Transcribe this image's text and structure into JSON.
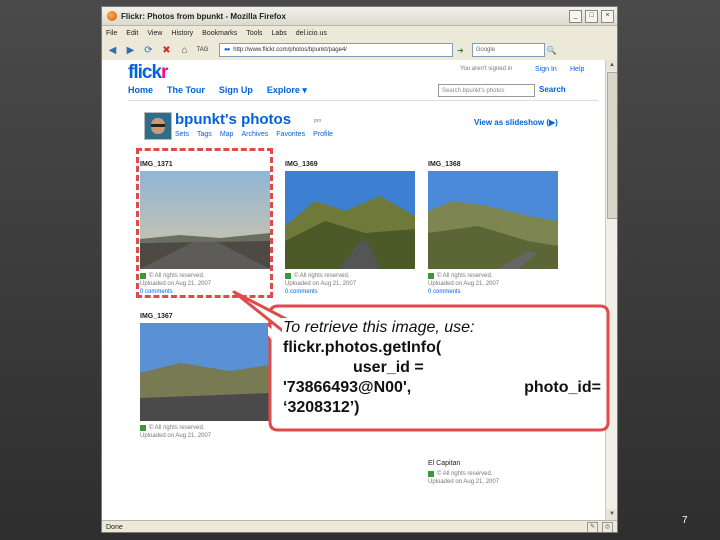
{
  "browser": {
    "title": "Flickr: Photos from bpunkt - Mozilla Firefox",
    "menu": [
      "File",
      "Edit",
      "View",
      "History",
      "Bookmarks",
      "Tools",
      "Labs",
      "del.icio.us"
    ],
    "url": "http://www.flickr.com/photos/bpunkt/page4/",
    "tag_label": "TAG",
    "search_placeholder": "Google",
    "status": "Done"
  },
  "flickr": {
    "logo_a": "flick",
    "logo_b": "r",
    "signed_out": "You aren't signed in",
    "sign_in": "Sign In",
    "help": "Help",
    "nav": [
      "Home",
      "The Tour",
      "Sign Up",
      "Explore ▾"
    ],
    "search_placeholder": "Search bpunkt's photos",
    "search_button": "Search",
    "owner_title": "bpunkt's photos",
    "badge": "pro",
    "subnav": [
      "Sets",
      "Tags",
      "Map",
      "Archives",
      "Favorites",
      "Profile"
    ],
    "slideshow": "View as slideshow (▶)"
  },
  "photos": [
    {
      "title": "IMG_1371",
      "license": "© All rights reserved.",
      "uploaded": "Uploaded on Aug 21, 2007",
      "comments": "0 comments"
    },
    {
      "title": "IMG_1369",
      "license": "© All rights reserved.",
      "uploaded": "Uploaded on Aug 21, 2007",
      "comments": "0 comments"
    },
    {
      "title": "IMG_1368",
      "license": "© All rights reserved.",
      "uploaded": "Uploaded on Aug 21, 2007",
      "comments": "0 comments"
    },
    {
      "title": "IMG_1367",
      "license": "© All rights reserved.",
      "uploaded": "Uploaded on Aug 21, 2007",
      "comments": ""
    },
    {
      "title": "El Capitan",
      "license": "© All rights reserved.",
      "uploaded": "Uploaded on Aug 21, 2007",
      "comments": ""
    }
  ],
  "callout": {
    "line1": "To retrieve this image, use:",
    "line2": "flickr.photos.getInfo(",
    "line3": "user_id =",
    "line4a": "'73866493@N00',",
    "line4b": "photo_id=",
    "line5": "‘3208312’)"
  },
  "slide_number": "7",
  "colors": {
    "highlight": "#e04a4a",
    "flickr_blue": "#0063dc",
    "flickr_pink": "#ff0084"
  }
}
